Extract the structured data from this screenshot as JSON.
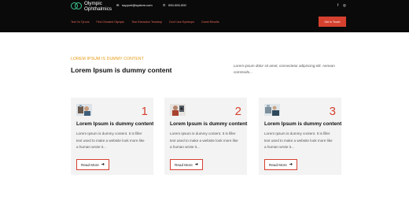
{
  "brand": {
    "line1": "Olympic",
    "line2": "Ophthalmics",
    "accent": "#3cc48e"
  },
  "contact": {
    "email": "support@system.com",
    "phone": "000-000-000"
  },
  "social": {
    "facebook": "f",
    "instagram": "◎"
  },
  "nav": [
    "Test Vs Tyruns",
    "Find Cheated Olympic",
    "Tear Extraction Teardrop",
    "Don't Use Eyedrops",
    "Guest Results"
  ],
  "cta_label": "Get in Touch",
  "colors": {
    "accent": "#d6412f",
    "eyebrow": "#e89b16",
    "header_bg": "#0a0a0a"
  },
  "intro": {
    "eyebrow": "LOREM IPSUM IS DUMMY CONTENT",
    "title": "Lorem Ipsum is dummy content",
    "text": "Lorem ipsum dolor sit amet, consectetur adipiscing elit. Aenean commodo..."
  },
  "cards": [
    {
      "number": "1",
      "title": "Lorem Ipsum is dummy content",
      "text": "Lorem Ipsum is dummy content. It is filler text used to make a website look more like a human wrote it...",
      "button": "Read More",
      "icon": "eye-exam-icon"
    },
    {
      "number": "2",
      "title": "Lorem Ipsum is dummy content",
      "text": "Lorem Ipsum is dummy content. It is filler text used to make a website look more like a human wrote it...",
      "button": "Read More",
      "icon": "eye-test-icon"
    },
    {
      "number": "3",
      "title": "Lorem Ipsum is dummy content",
      "text": "Lorem Ipsum is dummy content. It is filler text used to make a website look more like a human wrote it...",
      "button": "Read More",
      "icon": "optometry-icon"
    }
  ]
}
